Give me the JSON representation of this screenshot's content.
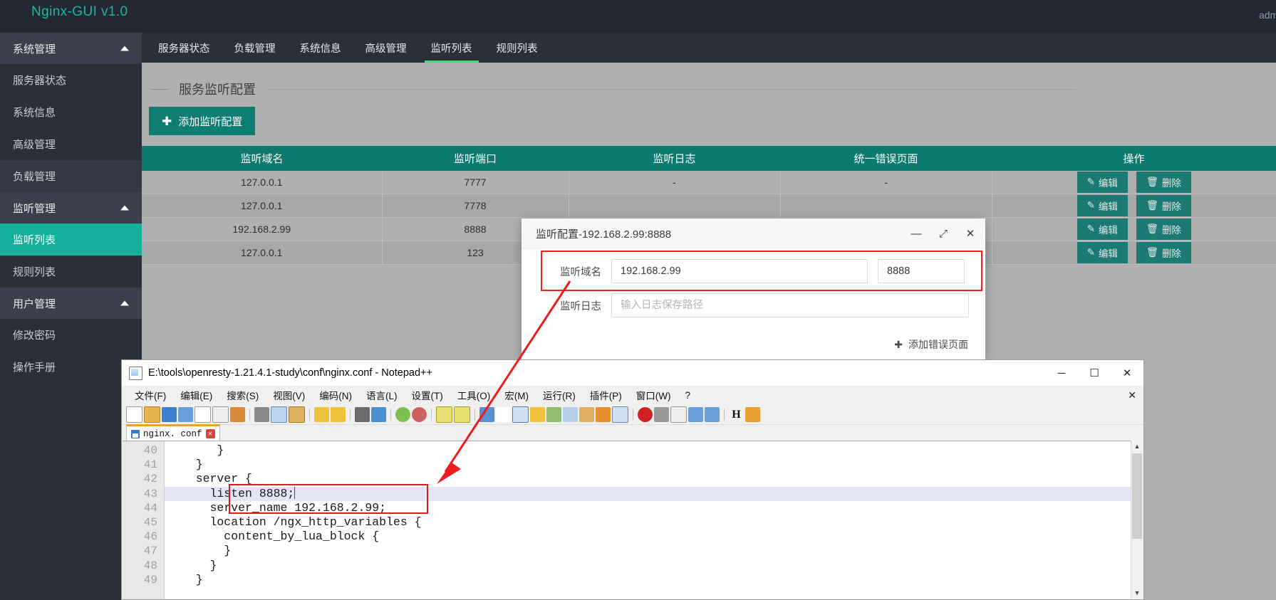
{
  "app": {
    "brand": "Nginx-GUI v1.0",
    "user": "adm",
    "sidebar": [
      {
        "label": "系统管理",
        "type": "group"
      },
      {
        "label": "服务器状态",
        "type": "item"
      },
      {
        "label": "系统信息",
        "type": "item"
      },
      {
        "label": "高级管理",
        "type": "item"
      },
      {
        "label": "负载管理",
        "type": "item-alt"
      },
      {
        "label": "监听管理",
        "type": "group"
      },
      {
        "label": "监听列表",
        "type": "item-active"
      },
      {
        "label": "规则列表",
        "type": "item"
      },
      {
        "label": "用户管理",
        "type": "group"
      },
      {
        "label": "修改密码",
        "type": "item"
      },
      {
        "label": "操作手册",
        "type": "item"
      }
    ],
    "tabs": [
      {
        "label": "服务器状态",
        "active": false
      },
      {
        "label": "负载管理",
        "active": false
      },
      {
        "label": "系统信息",
        "active": false
      },
      {
        "label": "高级管理",
        "active": false
      },
      {
        "label": "监听列表",
        "active": true
      },
      {
        "label": "规则列表",
        "active": false
      }
    ],
    "panel_title": "服务监听配置",
    "add_button": "添加监听配置",
    "table": {
      "headers": [
        "监听域名",
        "监听端口",
        "监听日志",
        "统一错误页面",
        "操作"
      ],
      "rows": [
        {
          "domain": "127.0.0.1",
          "port": "7777",
          "log": "-",
          "errpage": "-"
        },
        {
          "domain": "127.0.0.1",
          "port": "7778",
          "log": "",
          "errpage": ""
        },
        {
          "domain": "192.168.2.99",
          "port": "8888",
          "log": "",
          "errpage": ""
        },
        {
          "domain": "127.0.0.1",
          "port": "123",
          "log": "",
          "errpage": ""
        }
      ],
      "edit_label": "编辑",
      "delete_label": "删除"
    }
  },
  "modal": {
    "title": "监听配置-192.168.2.99:8888",
    "minimize": "—",
    "maximize": "⤢",
    "close": "✕",
    "domain_label": "监听域名",
    "domain_value": "192.168.2.99",
    "port_value": "8888",
    "log_label": "监听日志",
    "log_placeholder": "输入日志保存路径",
    "add_errpage": "添加错误页面",
    "add_errpage_plus": "✚"
  },
  "notepad": {
    "title": "E:\\tools\\openresty-1.21.4.1-study\\conf\\nginx.conf - Notepad++",
    "minimize": "─",
    "maximize": "☐",
    "close": "✕",
    "menu": [
      "文件(F)",
      "编辑(E)",
      "搜索(S)",
      "视图(V)",
      "编码(N)",
      "语言(L)",
      "设置(T)",
      "工具(O)",
      "宏(M)",
      "运行(R)",
      "插件(P)",
      "窗口(W)",
      "?"
    ],
    "menu_close": "✕",
    "tab_name": "nginx. conf",
    "tab_close": "✕",
    "scroll_up": "▲",
    "scroll_down": "▼",
    "lines": [
      {
        "num": "40",
        "text": "      }",
        "hl": false
      },
      {
        "num": "41",
        "text": "   }",
        "hl": false
      },
      {
        "num": "42",
        "text": "   server {",
        "hl": false
      },
      {
        "num": "43",
        "text": "     listen 8888;",
        "hl": true,
        "cursor": true
      },
      {
        "num": "44",
        "text": "     server_name 192.168.2.99;",
        "hl": false
      },
      {
        "num": "45",
        "text": "     location /ngx_http_variables {",
        "hl": false
      },
      {
        "num": "46",
        "text": "       content_by_lua_block {",
        "hl": false
      },
      {
        "num": "47",
        "text": "       }",
        "hl": false
      },
      {
        "num": "48",
        "text": "     }",
        "hl": false
      },
      {
        "num": "49",
        "text": "   }",
        "hl": false
      }
    ]
  },
  "colors": {
    "brand_green": "#19b99a",
    "header_teal": "#0c7a6f",
    "active_nav": "#3ee07a",
    "annotation_red": "#ee1c1c",
    "sidebar_dark": "#2b2f3a"
  }
}
